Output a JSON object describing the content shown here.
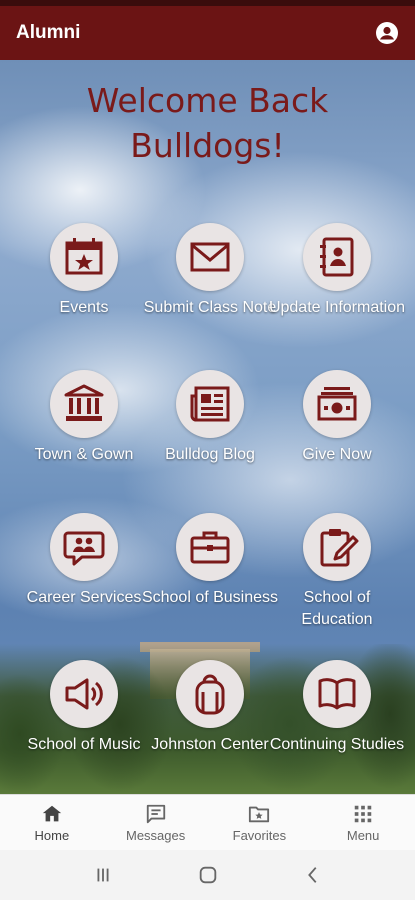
{
  "appbar": {
    "title": "Alumni",
    "account_icon": "account-circle-icon"
  },
  "hero": {
    "welcome_line1": "Welcome Back",
    "welcome_line2": "Bulldogs!"
  },
  "tiles": [
    {
      "label": "Events",
      "icon": "calendar-star-icon"
    },
    {
      "label": "Submit Class Note",
      "icon": "envelope-icon"
    },
    {
      "label": "Update Information",
      "icon": "address-book-icon"
    },
    {
      "label": "Town & Gown",
      "icon": "bank-building-icon"
    },
    {
      "label": "Bulldog Blog",
      "icon": "newspaper-icon"
    },
    {
      "label": "Give Now",
      "icon": "money-bill-icon"
    },
    {
      "label": "Career Services",
      "icon": "chat-people-icon"
    },
    {
      "label": "School of Business",
      "icon": "briefcase-icon"
    },
    {
      "label": "School of Education",
      "icon": "clipboard-pencil-icon"
    },
    {
      "label": "School of Music",
      "icon": "speaker-icon"
    },
    {
      "label": "Johnston Center",
      "icon": "backpack-icon"
    },
    {
      "label": "Continuing Studies",
      "icon": "open-book-icon"
    }
  ],
  "bottomnav": [
    {
      "label": "Home",
      "icon": "home-icon"
    },
    {
      "label": "Messages",
      "icon": "messages-icon"
    },
    {
      "label": "Favorites",
      "icon": "favorites-folder-icon"
    },
    {
      "label": "Menu",
      "icon": "grid-menu-icon"
    }
  ],
  "system_nav": {
    "recents_icon": "recents-icon",
    "home_icon": "system-home-icon",
    "back_icon": "back-icon"
  },
  "colors": {
    "brand": "#6b1414",
    "accent": "#7a1a1a",
    "tile_bg": "#e9e4e4"
  }
}
